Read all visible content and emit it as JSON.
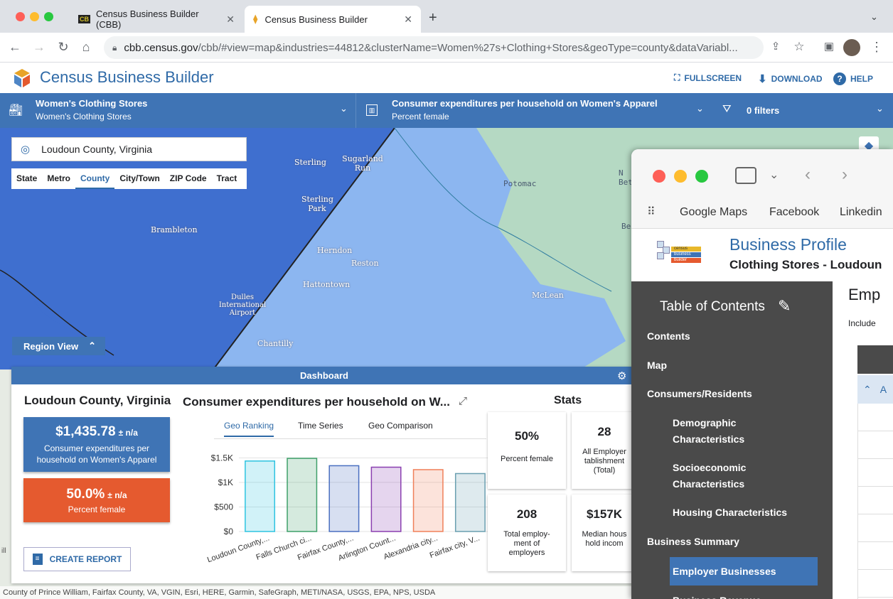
{
  "browser": {
    "tabs": [
      {
        "label": "Census Business Builder (CBB)",
        "favicon": "CB"
      },
      {
        "label": "Census Business Builder"
      }
    ],
    "url_host": "cbb.census.gov",
    "url_path": "/cbb/#view=map&industries=44812&clusterName=Women%27s+Clothing+Stores&geoType=county&dataVariabl..."
  },
  "app": {
    "title": "Census Business Builder",
    "fullscreen_label": "FULLSCREEN",
    "download_label": "DOWNLOAD",
    "help_label": "HELP",
    "brand_color": "#3f74b5"
  },
  "selectors": {
    "industry_title": "Women's Clothing Stores",
    "industry_sub": "Women's Clothing Stores",
    "variable_title": "Consumer expenditures per household on Women's Apparel",
    "variable_sub": "Percent female",
    "filters_label": "0 filters"
  },
  "map": {
    "search_value": "Loudoun County, Virginia",
    "geo_tabs": [
      "State",
      "Metro",
      "County",
      "City/Town",
      "ZIP Code",
      "Tract"
    ],
    "geo_selected": "County",
    "region_view_label": "Region View",
    "labels": [
      "Sterling",
      "Sugarland Run",
      "Sterling Park",
      "Brambleton",
      "Dulles International Airport",
      "Herndon",
      "Reston",
      "Hattontown",
      "Chantilly",
      "Potomac",
      "McLean",
      "N Bet",
      "Be"
    ],
    "attribution": "County of Prince William, Fairfax County, VA, VGIN, Esri, HERE, Garmin, SafeGraph, METI/NASA, USGS, EPA, NPS, USDA",
    "edge_label": "ill"
  },
  "dashboard": {
    "header": "Dashboard",
    "region_title": "Loudoun County, Virginia",
    "kpi1": {
      "value": "$1,435.78",
      "moe": "± n/a",
      "label": "Consumer expenditures per household on Women's Apparel",
      "color": "#3f74b5"
    },
    "kpi2": {
      "value": "50.0%",
      "moe": "± n/a",
      "label": "Percent female",
      "color": "#e55a2f"
    },
    "create_report_label": "CREATE REPORT",
    "chart_title": "Consumer expenditures per household on W...",
    "chart_tabs": [
      "Geo Ranking",
      "Time Series",
      "Geo Comparison"
    ],
    "chart_tab_selected": "Geo Ranking",
    "stats_title": "Stats",
    "stats": [
      {
        "value": "50%",
        "label": "Percent female"
      },
      {
        "value": "28",
        "label": "All Employer tablishment (Total)"
      },
      {
        "value": "208",
        "label": "Total employ-ment of employers"
      },
      {
        "value": "$157K",
        "label": "Median hous hold incom"
      }
    ]
  },
  "chart_data": {
    "type": "bar",
    "categories": [
      "Loudoun County,...",
      "Falls Church ci...",
      "Fairfax County,...",
      "Arlington Count...",
      "Alexandria city...",
      "Fairfax city, V..."
    ],
    "values": [
      1435.78,
      1490,
      1340,
      1310,
      1260,
      1180
    ],
    "yticks": [
      "$0",
      "$500",
      "$1K",
      "$1.5K"
    ],
    "ylim": [
      0,
      1650
    ],
    "colors": [
      "#2ec4e0",
      "#3fa06a",
      "#4a6fc0",
      "#8a3fb0",
      "#f0805a",
      "#6a9fb0"
    ],
    "grid": true
  },
  "profile_window": {
    "bookmarks": [
      "Google Maps",
      "Facebook",
      "Linkedin"
    ],
    "title": "Business Profile",
    "subtitle": "Clothing Stores - Loudoun",
    "logo_words": [
      "census",
      "business",
      "builder"
    ],
    "toc_title": "Table of Contents",
    "toc_items": [
      {
        "label": "Contents",
        "level": 0
      },
      {
        "label": "Map",
        "level": 0
      },
      {
        "label": "Consumers/Residents",
        "level": 0
      },
      {
        "label": "Demographic Characteristics",
        "level": 1
      },
      {
        "label": "Socioeconomic Characteristics",
        "level": 1
      },
      {
        "label": "Housing Characteristics",
        "level": 1
      },
      {
        "label": "Business Summary",
        "level": 0
      },
      {
        "label": "Employer Businesses",
        "level": 1
      },
      {
        "label": "Business Revenue",
        "level": 1
      }
    ],
    "toc_selected": "Employer Businesses",
    "main_heading": "Emp",
    "main_text": "Include",
    "row_label": "A"
  }
}
